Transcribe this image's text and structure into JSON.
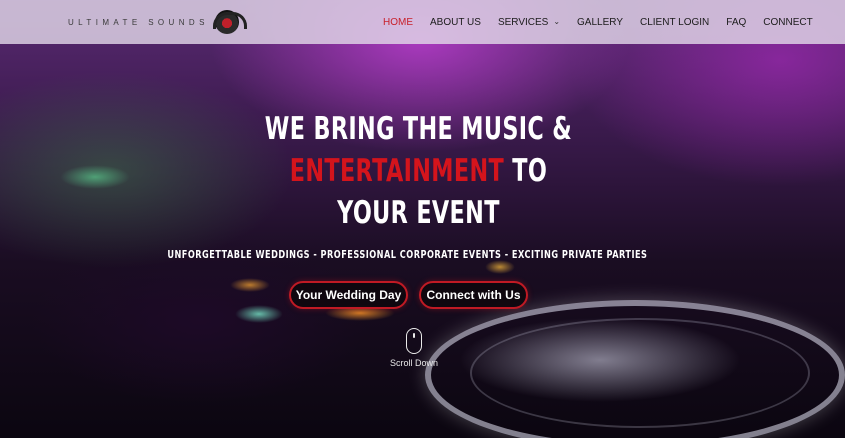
{
  "site": {
    "logo_text": "ULTIMATE SOUNDS",
    "logo_icon": "headphones-record-icon"
  },
  "nav": {
    "items": [
      {
        "label": "HOME",
        "active": true
      },
      {
        "label": "ABOUT US",
        "active": false
      },
      {
        "label": "SERVICES",
        "active": false,
        "has_dropdown": true
      },
      {
        "label": "GALLERY",
        "active": false
      },
      {
        "label": "CLIENT LOGIN",
        "active": false
      },
      {
        "label": "FAQ",
        "active": false
      },
      {
        "label": "CONNECT",
        "active": false
      }
    ]
  },
  "hero": {
    "line1": "WE BRING THE MUSIC &",
    "line2_highlight": "ENTERTAINMENT",
    "line2_rest": " TO",
    "line3": "YOUR EVENT",
    "tagline": "UNFORGETTABLE WEDDINGS - PROFESSIONAL CORPORATE EVENTS - EXCITING PRIVATE PARTIES",
    "buttons": [
      {
        "label": "Your Wedding Day"
      },
      {
        "label": "Connect with Us"
      }
    ],
    "scroll_label": "Scroll Down",
    "scroll_icon": "mouse-icon"
  },
  "colors": {
    "accent_red": "#d4141c",
    "header_bg": "#e1d7e8",
    "nav_text": "#1c1c1c"
  }
}
